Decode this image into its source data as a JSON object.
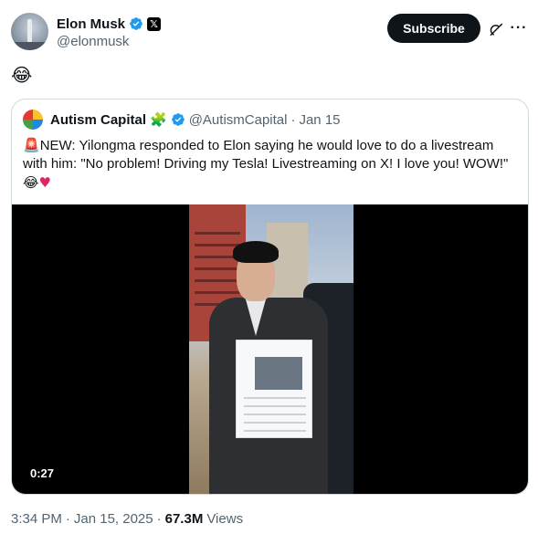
{
  "author": {
    "display_name": "Elon Musk",
    "handle": "@elonmusk",
    "avatar_icon": "rocket-launch-avatar",
    "x_badge": "𝕏"
  },
  "actions": {
    "subscribe_label": "Subscribe",
    "more_label": "···"
  },
  "tweet": {
    "text": "😂"
  },
  "quote": {
    "display_name": "Autism Capital",
    "puzzle_emoji": "🧩",
    "handle": "@AutismCapital",
    "date_sep": "·",
    "date": "Jan 15",
    "siren_emoji": "🚨",
    "body": "NEW: Yilongma responded to Elon saying he would love to do a livestream with him: \"No problem! Driving my Tesla! Livestreaming on X! I love you! WOW!\"",
    "trailing_laugh": "😂",
    "trailing_heart": "♥",
    "video_duration": "0:27"
  },
  "meta": {
    "time": "3:34 PM",
    "sep1": "·",
    "date": "Jan 15, 2025",
    "sep2": "·",
    "views_count": "67.3M",
    "views_label": "Views"
  },
  "colors": {
    "verified_blue": "#1d9bf0",
    "text_primary": "#0f1419",
    "text_secondary": "#536471",
    "border": "#cfd9de"
  }
}
